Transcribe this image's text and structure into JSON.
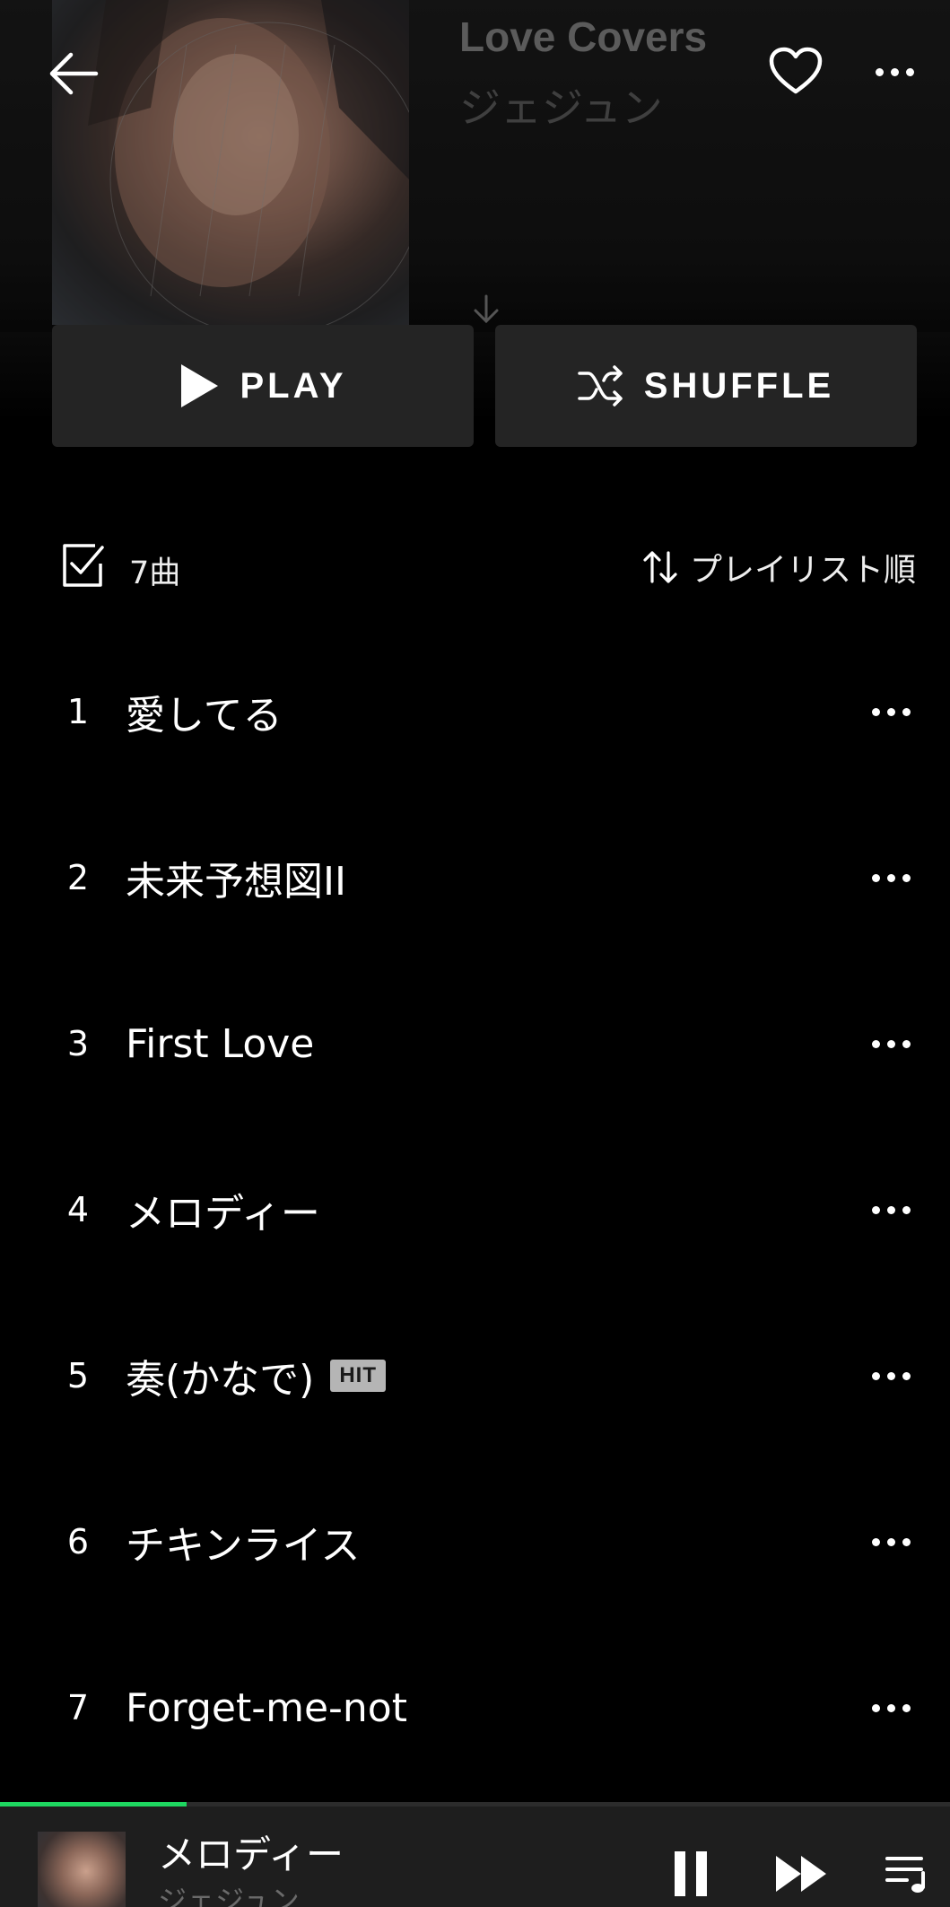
{
  "album": {
    "title": "Love Covers",
    "artist": "ジェジュン"
  },
  "actions": {
    "play_label": "PLAY",
    "shuffle_label": "SHUFFLE"
  },
  "list_meta": {
    "count_label": "7曲",
    "sort_label": "プレイリスト順"
  },
  "tracks": [
    {
      "num": "1",
      "title": "愛してる"
    },
    {
      "num": "2",
      "title": "未来予想図II"
    },
    {
      "num": "3",
      "title": "First Love"
    },
    {
      "num": "4",
      "title": "メロディー"
    },
    {
      "num": "5",
      "title": "奏(かなで)",
      "badge": "HIT"
    },
    {
      "num": "6",
      "title": "チキンライス"
    },
    {
      "num": "7",
      "title": "Forget-me-not"
    }
  ],
  "now_playing": {
    "title": "メロディー",
    "artist": "ジェジュン",
    "progress": 0.196
  },
  "colors": {
    "accent": "#1ed760",
    "background": "#000000",
    "button_bg": "#242424",
    "badge_bg": "#b5b5b5"
  },
  "icons": [
    "back-arrow-icon",
    "heart-icon",
    "more-icon",
    "play-icon",
    "shuffle-icon",
    "checkbox-icon",
    "sort-icon",
    "pause-icon",
    "next-icon",
    "queue-icon"
  ]
}
